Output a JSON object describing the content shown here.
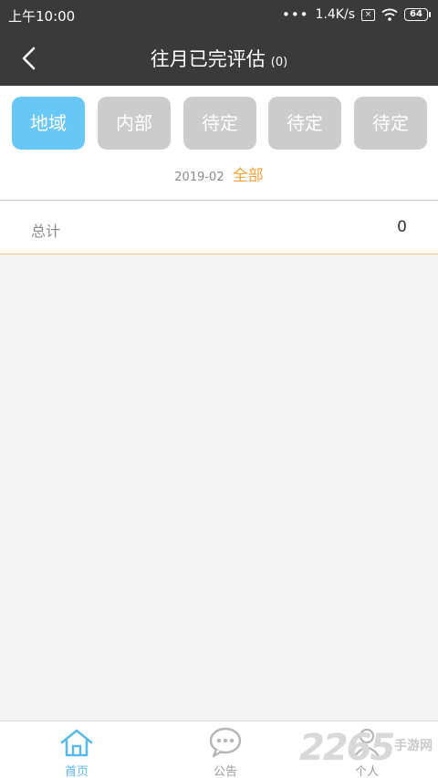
{
  "status_bar": {
    "time": "上午10:00",
    "dots": "•••",
    "network_speed": "1.4K/s",
    "battery_level": "64",
    "icons": [
      "more-dots-icon",
      "sim-icon",
      "wifi-icon",
      "battery-icon"
    ]
  },
  "header": {
    "title": "往月已完评估",
    "count": "(0)",
    "back_icon": "chevron-left-icon"
  },
  "filters": {
    "buttons": [
      {
        "label": "地域",
        "active": true
      },
      {
        "label": "内部",
        "active": false
      },
      {
        "label": "待定",
        "active": false
      },
      {
        "label": "待定",
        "active": false
      },
      {
        "label": "待定",
        "active": false
      }
    ],
    "date": "2019-02",
    "all_label": "全部"
  },
  "summary": {
    "label": "总计",
    "value": "0"
  },
  "tabbar": {
    "tabs": [
      {
        "label": "首页",
        "icon": "home-icon",
        "active": true
      },
      {
        "label": "公告",
        "icon": "chat-bubble-icon",
        "active": false
      },
      {
        "label": "个人",
        "icon": "person-icon",
        "active": false
      }
    ]
  },
  "watermark": {
    "digits": "2265",
    "text": "手游网"
  },
  "colors": {
    "header_bg": "#3a3a3a",
    "active_filter": "#69c7f7",
    "inactive_filter": "#cccccc",
    "accent_orange": "#f3a23b",
    "active_tab": "#5ab8ea"
  }
}
